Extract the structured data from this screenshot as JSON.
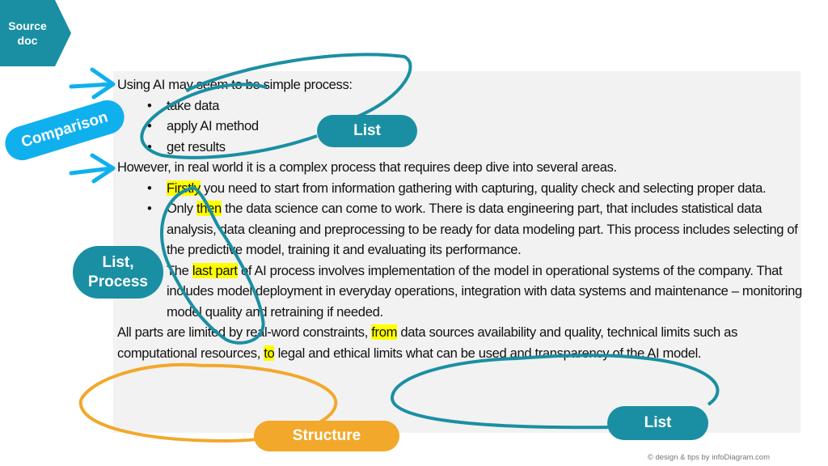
{
  "colors": {
    "teal": "#1a8fa3",
    "blue": "#10b0ee",
    "orange": "#f2a82a",
    "highlight": "#ffff00",
    "panel": "#f2f2f2"
  },
  "source_tag": {
    "line1": "Source",
    "line2": "doc"
  },
  "document": {
    "intro": "Using AI may seem to be simple process:",
    "simple_steps": [
      "take data",
      "apply AI method",
      "get results"
    ],
    "however": "However, in real world it is a complex process that requires deep dive into several areas.",
    "complex_steps": [
      {
        "highlight": "Firstly",
        "rest": " you need to start from information gathering with capturing, quality check and selecting proper data."
      },
      {
        "before": "Only ",
        "highlight": "then",
        "rest": " the data science can come to work. There is data engineering part, that includes statistical data analysis, data cleaning and preprocessing to be ready for data modeling part. This process includes selecting of the predictive model, training it and evaluating its performance."
      },
      {
        "before": "The ",
        "highlight": "last part",
        "rest": " of AI process involves implementation of the model in operational systems of the company. That includes model deployment in everyday operations, integration with data systems and maintenance – monitoring model quality and retraining if needed."
      }
    ],
    "conclusion": {
      "part1": "All parts are limited by real-word constraints, ",
      "hl1": "from",
      "part2": " data sources availability and quality, technical limits such as computational resources, ",
      "hl2": "to",
      "part3": " legal and ethical limits what can be used and transparency of the AI model."
    }
  },
  "annotations": {
    "comparison": "Comparison",
    "list_top": "List",
    "list_process_line1": "List,",
    "list_process_line2": "Process",
    "structure": "Structure",
    "list_bottom": "List"
  },
  "footer": "© design & tips by infoDiagram.com"
}
